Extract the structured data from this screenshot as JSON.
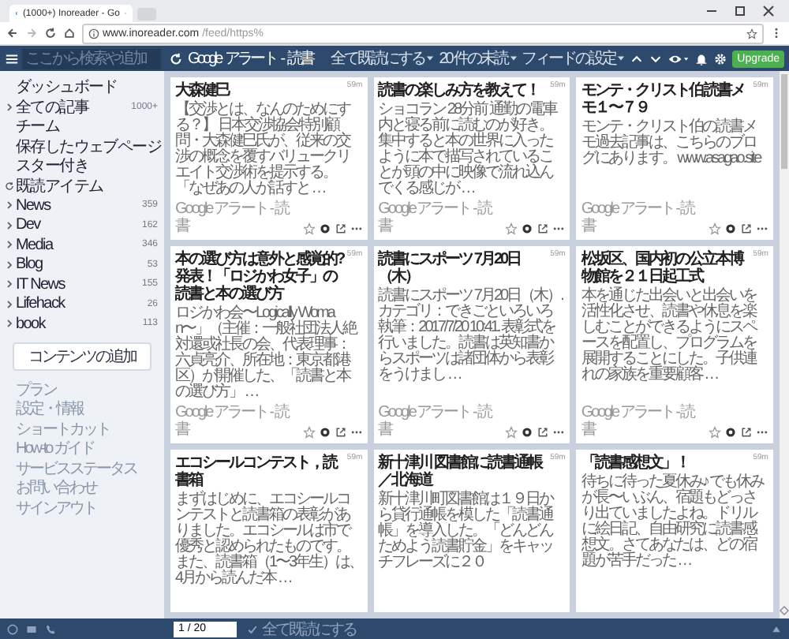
{
  "browser": {
    "tab_title": "(1000+) Inoreader - Go",
    "url_host": "www.inoreader.com",
    "url_path": "/feed/https%"
  },
  "toolbar": {
    "search_placeholder": "ここから検索や追加",
    "title": "Google アラート - 読書",
    "menus": [
      "全て既読にする",
      "20 件の未読",
      "フィードの設定"
    ],
    "upgrade": "Upgrade"
  },
  "sidebar": {
    "items": [
      {
        "label": "ダッシュボード",
        "kind": "plain"
      },
      {
        "label": "全ての記事",
        "kind": "folder",
        "count": "1000+"
      },
      {
        "label": "チーム",
        "kind": "plain"
      },
      {
        "label": "保存したウェブページ",
        "kind": "plain"
      },
      {
        "label": "スター付き",
        "kind": "plain"
      },
      {
        "label": "既読アイテム",
        "kind": "history"
      },
      {
        "label": "News",
        "kind": "folder",
        "count": "359"
      },
      {
        "label": "Dev",
        "kind": "folder",
        "count": "162"
      },
      {
        "label": "Media",
        "kind": "folder",
        "count": "346"
      },
      {
        "label": "Blog",
        "kind": "folder",
        "count": "53"
      },
      {
        "label": "IT News",
        "kind": "folder",
        "count": "155"
      },
      {
        "label": "Lifehack",
        "kind": "folder",
        "count": "26"
      },
      {
        "label": "book",
        "kind": "folder",
        "count": "113"
      }
    ],
    "add_button": "コンテンツの追加",
    "links": [
      "プラン",
      "設定・情報",
      "ショートカット",
      "How-to ガイド",
      "サービスステータス",
      "お問い合わせ",
      "サインアウト"
    ]
  },
  "cards": [
    {
      "title": "大森健巳",
      "time": "59m",
      "body": "【交渉とは、なんのためにする？】 日本交渉協会特別顧問・大森健巳氏が、従来の交渉の概念を覆すバリュークリエイト交渉術を提示する。「なぜあの人が話すと …",
      "source": "Google アラート - 読書"
    },
    {
      "title": "読書の楽しみ方を教えて！",
      "time": "59m",
      "body": "ショコラン 28分前 通勤の電車内と寝る前に読むのが好き。集中すると本の世界に入ったように本で描写されていることが頭の中に映像で流れ込んでくる感じが …",
      "source": "Google アラート - 読書"
    },
    {
      "title": "モンテ・クリスト伯 読書メモ１〜７９",
      "time": "59m",
      "body": "モンテ・クリスト伯の読書メモ過去記事は、こちらのブログにあります。 www.asagao.site",
      "source": "Google アラート - 読書"
    },
    {
      "title": "本の選び方は意外と感覚的?発表！「ロジかわ女子」の読書と本の選び方",
      "time": "59m",
      "body": "ロジかわ会〜Logically Woman〜」（主催：一般社団法人絶対還或社長の会、代表理事：六貞亮介、所在地：東京都港区）が開催した、「読書と本の選び方」 …",
      "source": "Google アラート - 読書"
    },
    {
      "title": "読書にスポーツ 7月20日（木）",
      "time": "59m",
      "body": "読書にスポーツ 7月20日（木）. カテゴリ：できごといろいろ執筆：2017/7/20 10:41. 表彰式を行いました。読書は英知書からスポーツは諸団体から表彰をうけまし …",
      "source": "Google アラート - 読書"
    },
    {
      "title": "松坂区、国内初の公立本博物館を２１日起工式",
      "time": "59m",
      "body": "本を通じた出会いと出会いを活性化させ、読書や休息を楽しむことができるようにスペースを配置し、プログラムを展開することにした。子供連れの家族を重要顧客 …",
      "source": "Google アラート - 読書"
    },
    {
      "title": "エコシールコンテスト，読書箱",
      "time": "59m",
      "body": "まずはじめに、エコシールコンテストと読書箱の表彰がありました。エコシールは市で優秀と認められたものです。また、読書箱（1〜3年生）は、4月から読んだ本 …"
    },
    {
      "title": "新十津川 図書館に読書通帳／北海道",
      "time": "59m",
      "body": "新十津川町図書館は１９日から貸行通帳を模した「読書通帳」を導入した。「どんどんためよう読書貯金」をキャッチフレーズに２０"
    },
    {
      "title": "「読書感想文」！",
      "time": "59m",
      "body": "待ちに待った夏休み♪ でも休みが長〜いぶん、宿題もどっさり出ていましたよね。ドリルに絵日記、自由研究に読書感想文。さてあなたは、どの宿題が苦手だった …"
    }
  ],
  "bottom_bar": {
    "page": "1 / 20",
    "mark_all": "全て既読にする"
  }
}
